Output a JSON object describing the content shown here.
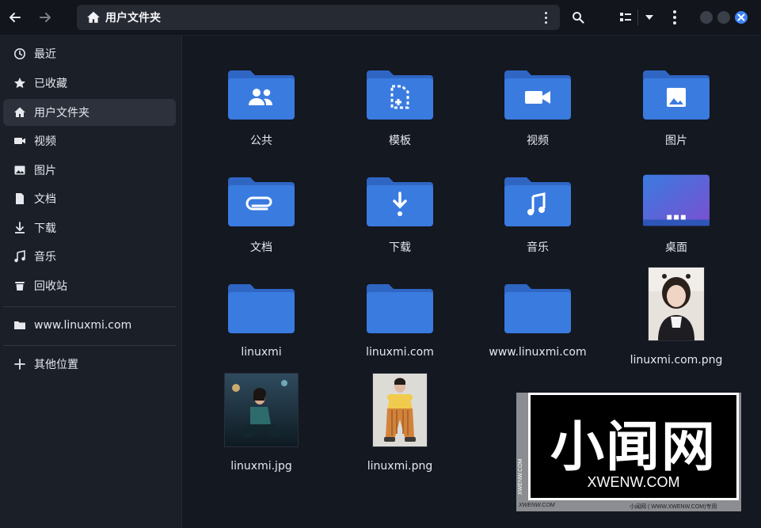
{
  "header": {
    "back_icon": "arrow-left-icon",
    "forward_icon": "arrow-right-icon",
    "path_label": "用户文件夹",
    "search_icon": "search-icon",
    "view_icon": "list-view-icon",
    "menu_icon": "kebab-menu-icon"
  },
  "sidebar": {
    "items": [
      {
        "label": "最近",
        "icon": "clock-icon"
      },
      {
        "label": "已收藏",
        "icon": "star-icon"
      },
      {
        "label": "用户文件夹",
        "icon": "home-icon",
        "active": true
      },
      {
        "label": "视频",
        "icon": "video-icon"
      },
      {
        "label": "图片",
        "icon": "image-icon"
      },
      {
        "label": "文档",
        "icon": "document-icon"
      },
      {
        "label": "下载",
        "icon": "download-icon"
      },
      {
        "label": "音乐",
        "icon": "music-icon"
      },
      {
        "label": "回收站",
        "icon": "trash-icon"
      }
    ],
    "bookmark": {
      "label": "www.linuxmi.com",
      "icon": "folder-icon"
    },
    "other": {
      "label": "其他位置",
      "icon": "plus-icon"
    }
  },
  "files": [
    {
      "name": "公共",
      "type": "folder",
      "emblem": "people"
    },
    {
      "name": "模板",
      "type": "folder",
      "emblem": "template"
    },
    {
      "name": "视频",
      "type": "folder",
      "emblem": "video"
    },
    {
      "name": "图片",
      "type": "folder",
      "emblem": "image"
    },
    {
      "name": "文档",
      "type": "folder",
      "emblem": "paperclip"
    },
    {
      "name": "下载",
      "type": "folder",
      "emblem": "download"
    },
    {
      "name": "音乐",
      "type": "folder",
      "emblem": "music"
    },
    {
      "name": "桌面",
      "type": "desktop"
    },
    {
      "name": "linuxmi",
      "type": "folder"
    },
    {
      "name": "linuxmi.com",
      "type": "folder"
    },
    {
      "name": "www.linuxmi.com",
      "type": "folder"
    },
    {
      "name": "linuxmi.com.png",
      "type": "image"
    },
    {
      "name": "linuxmi.jpg",
      "type": "image"
    },
    {
      "name": "linuxmi.png",
      "type": "image"
    }
  ],
  "watermark": {
    "title": "小闻网",
    "subtitle": "XWENW.COM",
    "vertical": "XWENW.COM",
    "footer_left": "XWENW.COM",
    "footer_right": "小闻网 ( WWW.XWENW.COM)专用"
  },
  "colors": {
    "accent": "#3b82f6",
    "folder": "#3a7be0",
    "folder_tab": "#2f66c4"
  }
}
